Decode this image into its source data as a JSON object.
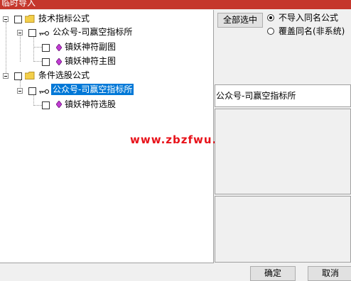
{
  "window": {
    "title": "临时导入"
  },
  "tree": {
    "group1": {
      "label": "技术指标公式",
      "child": {
        "label": "公众号-司赢空指标所",
        "items": [
          "镇妖神符副图",
          "镇妖神符主图"
        ]
      }
    },
    "group2": {
      "label": "条件选股公式",
      "child": {
        "label": "公众号-司赢空指标所",
        "items": [
          "镇妖神符选股"
        ]
      }
    }
  },
  "watermark": "www.zbzfwu.com",
  "options": {
    "select_all_label": "全部选中",
    "radio_no_import": "不导入同名公式",
    "radio_overwrite": "覆盖同名(非系统)",
    "selected_radio": "不导入同名公式"
  },
  "info": {
    "name": "公众号-司赢空指标所"
  },
  "buttons": {
    "ok": "确定",
    "cancel": "取消"
  },
  "colors": {
    "titlebar": "#c5372c",
    "selection": "#0078d7",
    "watermark": "#e8121a"
  }
}
